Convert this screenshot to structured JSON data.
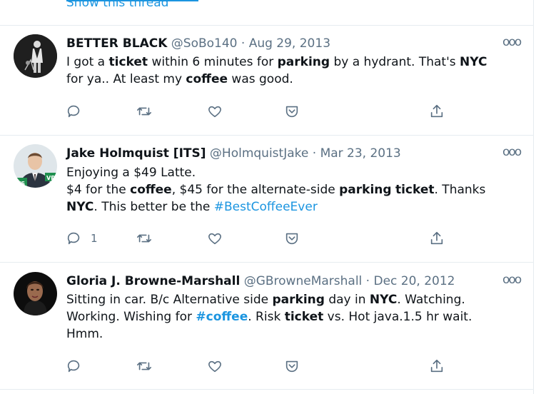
{
  "feed": {
    "show_thread_label": "Show this thread",
    "tweets": [
      {
        "name": "BETTER BLACK",
        "handle": "@SoBo140",
        "separator": "·",
        "date": "Aug 29, 2013",
        "more_label": "ooo",
        "body": [
          {
            "text": "I got a "
          },
          {
            "text": "ticket",
            "bold": true
          },
          {
            "text": " within 6 minutes for "
          },
          {
            "text": "parking",
            "bold": true
          },
          {
            "text": " by a hydrant. That's "
          },
          {
            "text": "NYC",
            "bold": true
          },
          {
            "text": "\nfor ya.. At least my "
          },
          {
            "text": "coffee",
            "bold": true
          },
          {
            "text": " was good."
          }
        ],
        "reply_count": ""
      },
      {
        "name": "Jake Holmquist [ITS]",
        "handle": "@HolmquistJake",
        "separator": "·",
        "date": "Mar 23, 2013",
        "more_label": "ooo",
        "body": [
          {
            "text": "Enjoying a $49 Latte.\n$4 for the "
          },
          {
            "text": "coffee",
            "bold": true
          },
          {
            "text": ", $45 for the alternate-side "
          },
          {
            "text": "parking",
            "bold": true
          },
          {
            "text": " "
          },
          {
            "text": "ticket",
            "bold": true
          },
          {
            "text": ".  Thanks\n"
          },
          {
            "text": "NYC",
            "bold": true
          },
          {
            "text": ".  This better be the "
          },
          {
            "text": "#BestCoffeeEver",
            "link": true
          }
        ],
        "reply_count": "1"
      },
      {
        "name": "Gloria J. Browne-Marshall",
        "handle": "@GBrowneMarshall",
        "separator": "·",
        "date": "Dec 20, 2012",
        "more_label": "ooo",
        "body": [
          {
            "text": "Sitting in car. B/c Alternative side "
          },
          {
            "text": "parking",
            "bold": true
          },
          {
            "text": " day in "
          },
          {
            "text": "NYC",
            "bold": true
          },
          {
            "text": ". Watching.\nWorking. Wishing for "
          },
          {
            "text": "#coffee",
            "link": true,
            "bold": true
          },
          {
            "text": ". Risk "
          },
          {
            "text": "ticket",
            "bold": true
          },
          {
            "text": " vs. Hot java.1.5 hr wait.\nHmm."
          }
        ],
        "reply_count": ""
      }
    ]
  },
  "colors": {
    "link": "#1b95e0",
    "muted": "#5b7083",
    "divider": "#e6ecf0",
    "avatar_jake_badge": "#1f8f4e"
  },
  "icons": [
    "reply-icon",
    "retweet-icon",
    "like-icon",
    "save-icon",
    "share-icon",
    "more-icon"
  ]
}
